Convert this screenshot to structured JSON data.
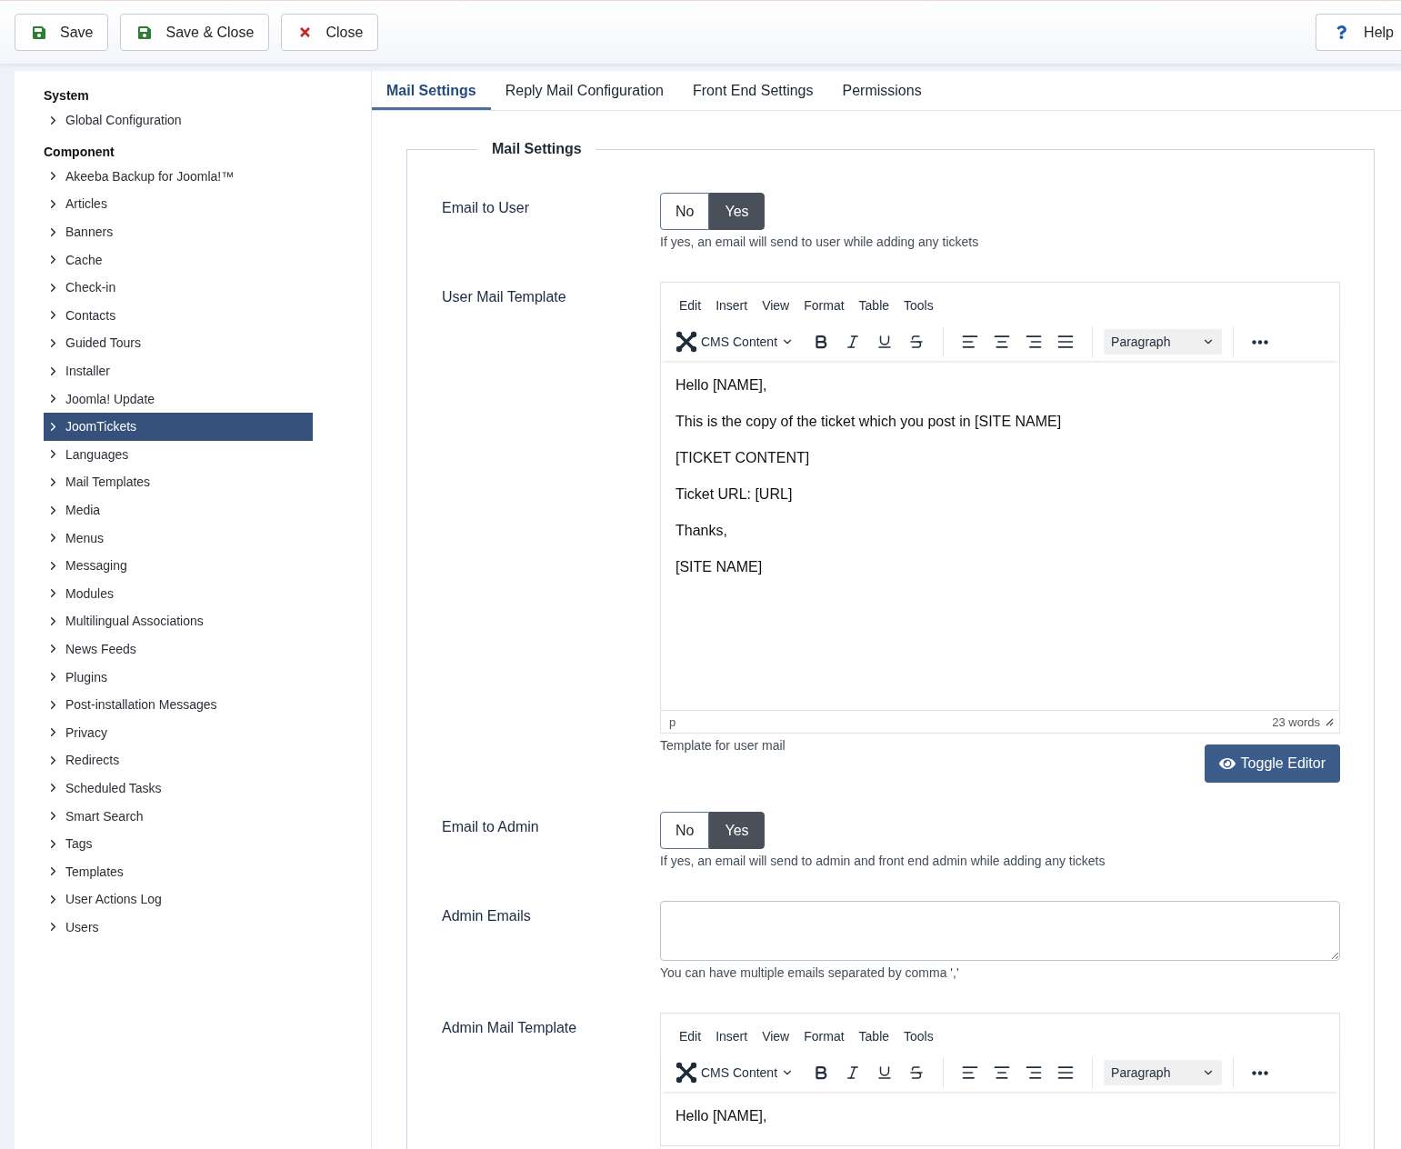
{
  "toolbar": {
    "buttons": [
      {
        "kind": "save",
        "label": "Save"
      },
      {
        "kind": "save",
        "label": "Save & Close"
      },
      {
        "kind": "close",
        "label": "Close"
      }
    ],
    "help": {
      "label": "Help"
    }
  },
  "sidebar": {
    "sections": [
      {
        "heading": "System",
        "items": [
          {
            "label": "Global Configuration",
            "selected": false
          }
        ]
      },
      {
        "heading": "Component",
        "items": [
          {
            "label": "Akeeba Backup for Joomla!™",
            "selected": false
          },
          {
            "label": "Articles",
            "selected": false
          },
          {
            "label": "Banners",
            "selected": false
          },
          {
            "label": "Cache",
            "selected": false
          },
          {
            "label": "Check-in",
            "selected": false
          },
          {
            "label": "Contacts",
            "selected": false
          },
          {
            "label": "Guided Tours",
            "selected": false
          },
          {
            "label": "Installer",
            "selected": false
          },
          {
            "label": "Joomla! Update",
            "selected": false
          },
          {
            "label": "JoomTickets",
            "selected": true
          },
          {
            "label": "Languages",
            "selected": false
          },
          {
            "label": "Mail Templates",
            "selected": false
          },
          {
            "label": "Media",
            "selected": false
          },
          {
            "label": "Menus",
            "selected": false
          },
          {
            "label": "Messaging",
            "selected": false
          },
          {
            "label": "Modules",
            "selected": false
          },
          {
            "label": "Multilingual Associations",
            "selected": false
          },
          {
            "label": "News Feeds",
            "selected": false
          },
          {
            "label": "Plugins",
            "selected": false
          },
          {
            "label": "Post-installation Messages",
            "selected": false
          },
          {
            "label": "Privacy",
            "selected": false
          },
          {
            "label": "Redirects",
            "selected": false
          },
          {
            "label": "Scheduled Tasks",
            "selected": false
          },
          {
            "label": "Smart Search",
            "selected": false
          },
          {
            "label": "Tags",
            "selected": false
          },
          {
            "label": "Templates",
            "selected": false
          },
          {
            "label": "User Actions Log",
            "selected": false
          },
          {
            "label": "Users",
            "selected": false
          }
        ]
      }
    ]
  },
  "tabs": [
    {
      "label": "Mail Settings",
      "selected": true
    },
    {
      "label": "Reply Mail Configuration",
      "selected": false
    },
    {
      "label": "Front End Settings",
      "selected": false
    },
    {
      "label": "Permissions",
      "selected": false
    }
  ],
  "fieldset": {
    "legend": "Mail Settings",
    "fields": [
      {
        "kind": "toggle",
        "label": "Email to User",
        "options": [
          {
            "label": "No",
            "selected": false
          },
          {
            "label": "Yes",
            "selected": true
          }
        ],
        "hint": "If yes, an email will send to user while adding any tickets"
      },
      {
        "kind": "editor",
        "label": "User Mail Template",
        "menu": [
          "Edit",
          "Insert",
          "View",
          "Format",
          "Table",
          "Tools"
        ],
        "source": "CMS Content",
        "block_format": "Paragraph",
        "paragraphs": [
          "Hello [NAME],",
          "This is the copy of the ticket which you post in [SITE NAME]",
          "[TICKET CONTENT]",
          "Ticket URL: [URL]",
          "Thanks,",
          "[SITE NAME]"
        ],
        "element_path": "p",
        "word_count": "23 words",
        "hint": "Template for user mail",
        "button": "Toggle Editor"
      },
      {
        "kind": "toggle",
        "label": "Email to Admin",
        "options": [
          {
            "label": "No",
            "selected": false
          },
          {
            "label": "Yes",
            "selected": true
          }
        ],
        "hint": "If yes, an email will send to admin and front end admin while adding any tickets"
      },
      {
        "kind": "textarea",
        "label": "Admin Emails",
        "hint": "You can have multiple emails separated by comma ','"
      },
      {
        "kind": "editor",
        "label": "Admin Mail Template",
        "menu": [
          "Edit",
          "Insert",
          "View",
          "Format",
          "Table",
          "Tools"
        ],
        "source": "CMS Content",
        "block_format": "Paragraph",
        "paragraphs": [
          "Hello [NAME],"
        ]
      }
    ]
  }
}
